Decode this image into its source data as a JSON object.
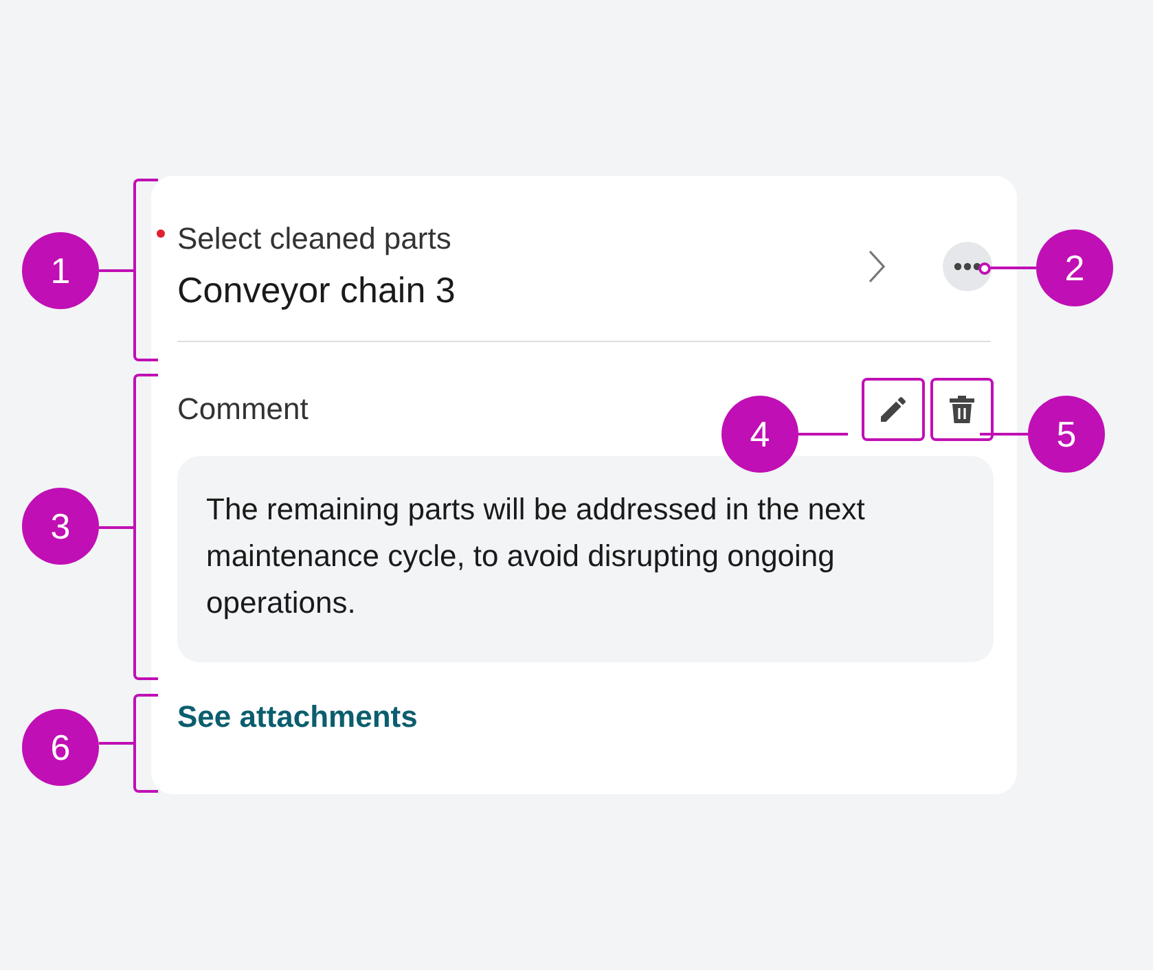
{
  "field": {
    "label": "Select cleaned parts",
    "required": true,
    "value": "Conveyor chain 3"
  },
  "comment": {
    "label": "Comment",
    "text": "The remaining parts will be addressed in the next maintenance cycle, to avoid disrupting ongoing operations."
  },
  "link": "See attachments",
  "callouts": [
    {
      "label": "1"
    },
    {
      "label": "2"
    },
    {
      "label": "3"
    },
    {
      "label": "4"
    },
    {
      "label": "5"
    },
    {
      "label": "6"
    }
  ]
}
